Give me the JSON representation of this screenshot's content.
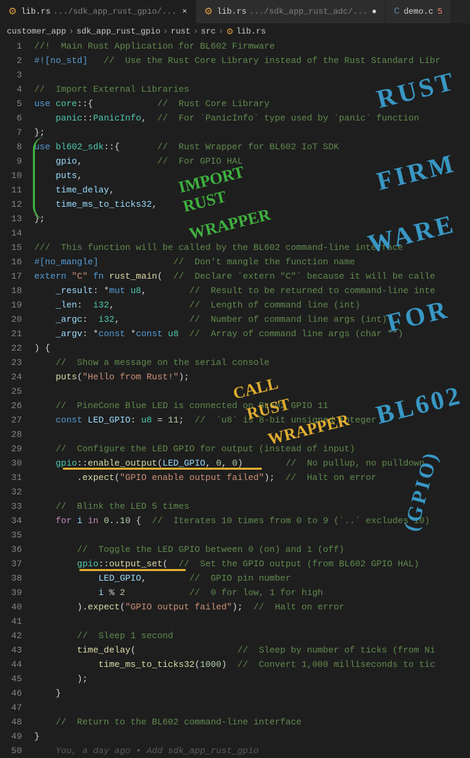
{
  "tabs": [
    {
      "icon": "⚙",
      "iconClass": "rust-icon",
      "name": "lib.rs",
      "path": ".../sdk_app_rust_gpio/...",
      "active": true,
      "close": true
    },
    {
      "icon": "⚙",
      "iconClass": "rust-icon",
      "name": "lib.rs",
      "path": ".../sdk_app_rust_adc/...",
      "active": false,
      "modified": true
    },
    {
      "icon": "C",
      "iconClass": "c-icon",
      "name": "demo.c",
      "count": "5",
      "active": false
    }
  ],
  "breadcrumbs": [
    "customer_app",
    "sdk_app_rust_gpio",
    "rust",
    "src",
    "lib.rs"
  ],
  "lines": [
    {
      "n": 1,
      "html": "<span class='doc-comment'>//!  Main Rust Application for BL602 Firmware</span>"
    },
    {
      "n": 2,
      "html": "<span class='attr'>#![no_std]</span>   <span class='comment'>//  Use the Rust Core Library instead of the Rust Standard Libr</span>"
    },
    {
      "n": 3,
      "html": ""
    },
    {
      "n": 4,
      "html": "<span class='comment'>//  Import External Libraries</span>"
    },
    {
      "n": 5,
      "html": "<span class='kw-use'>use</span> <span class='mod-name'>core</span><span class='punct'>::{</span>            <span class='comment'>//  Rust Core Library</span>"
    },
    {
      "n": 6,
      "html": "    <span class='mod-name'>panic</span><span class='punct'>::</span><span class='type'>PanicInfo</span><span class='punct'>,</span>  <span class='comment'>//  For `PanicInfo` type used by `panic` function</span>"
    },
    {
      "n": 7,
      "html": "<span class='punct'>};</span>"
    },
    {
      "n": 8,
      "html": "<span class='kw-use'>use</span> <span class='mod-name'>bl602_sdk</span><span class='punct'>::{</span>       <span class='comment'>//  Rust Wrapper for BL602 IoT SDK</span>"
    },
    {
      "n": 9,
      "html": "    <span class='ident'>gpio</span><span class='punct'>,</span>              <span class='comment'>//  For GPIO HAL</span>"
    },
    {
      "n": 10,
      "html": "    <span class='ident'>puts</span><span class='punct'>,</span>"
    },
    {
      "n": 11,
      "html": "    <span class='ident'>time_delay</span><span class='punct'>,</span>"
    },
    {
      "n": 12,
      "html": "    <span class='ident'>time_ms_to_ticks32</span><span class='punct'>,</span>"
    },
    {
      "n": 13,
      "html": "<span class='punct'>};</span>"
    },
    {
      "n": 14,
      "html": ""
    },
    {
      "n": 15,
      "html": "<span class='comment'>///  This function will be called by the BL602 command-line interface</span>"
    },
    {
      "n": 16,
      "html": "<span class='attr'>#[no_mangle]</span>              <span class='comment'>//  Don't mangle the function name</span>"
    },
    {
      "n": 17,
      "html": "<span class='keyword'>extern</span> <span class='string'>\"C\"</span> <span class='keyword'>fn</span> <span class='fn-name'>rust_main</span><span class='punct'>(</span>  <span class='comment'>//  Declare `extern \"C\"` because it will be calle</span>"
    },
    {
      "n": 18,
      "html": "    <span class='ident'>_result</span><span class='punct'>:</span> <span class='op'>*</span><span class='keyword'>mut</span> <span class='type'>u8</span><span class='punct'>,</span>        <span class='comment'>//  Result to be returned to command-line inte</span>"
    },
    {
      "n": 19,
      "html": "    <span class='ident'>_len</span><span class='punct'>:</span>  <span class='type'>i32</span><span class='punct'>,</span>              <span class='comment'>//  Length of command line (int)</span>"
    },
    {
      "n": 20,
      "html": "    <span class='ident'>_argc</span><span class='punct'>:</span>  <span class='type'>i32</span><span class='punct'>,</span>             <span class='comment'>//  Number of command line args (int)</span>"
    },
    {
      "n": 21,
      "html": "    <span class='ident'>_argv</span><span class='punct'>:</span> <span class='op'>*</span><span class='keyword'>const</span> <span class='op'>*</span><span class='keyword'>const</span> <span class='type'>u8</span>  <span class='comment'>//  Array of command line args (char **)</span>"
    },
    {
      "n": 22,
      "html": "<span class='punct'>) {</span>"
    },
    {
      "n": 23,
      "html": "    <span class='comment'>//  Show a message on the serial console</span>"
    },
    {
      "n": 24,
      "html": "    <span class='fn-name'>puts</span><span class='punct'>(</span><span class='string'>\"Hello from Rust!\"</span><span class='punct'>);</span>"
    },
    {
      "n": 25,
      "html": ""
    },
    {
      "n": 26,
      "html": "    <span class='comment'>//  PineCone Blue LED is connected on BL602 GPIO 11</span>"
    },
    {
      "n": 27,
      "html": "    <span class='kw-const'>const</span> <span class='ident'>LED_GPIO</span><span class='punct'>:</span> <span class='type'>u8</span> <span class='op'>=</span> <span class='number'>11</span><span class='punct'>;</span>  <span class='comment'>//  `u8` is 8-bit unsigned integer</span>"
    },
    {
      "n": 28,
      "html": ""
    },
    {
      "n": 29,
      "html": "    <span class='comment'>//  Configure the LED GPIO for output (instead of input)</span>"
    },
    {
      "n": 30,
      "html": "    <span class='mod-name'>gpio</span><span class='punct'>::</span><span class='fn-name'>enable_output</span><span class='punct'>(</span><span class='ident'>LED_GPIO</span><span class='punct'>,</span> <span class='number'>0</span><span class='punct'>,</span> <span class='number'>0</span><span class='punct'>)</span>        <span class='comment'>//  No pullup, no pulldown</span>"
    },
    {
      "n": 31,
      "html": "        <span class='punct'>.</span><span class='fn-name'>expect</span><span class='punct'>(</span><span class='string'>\"GPIO enable output failed\"</span><span class='punct'>);</span>  <span class='comment'>//  Halt on error</span>"
    },
    {
      "n": 32,
      "html": ""
    },
    {
      "n": 33,
      "html": "    <span class='comment'>//  Blink the LED 5 times</span>"
    },
    {
      "n": 34,
      "html": "    <span class='kw-for'>for</span> <span class='ident'>i</span> <span class='kw-in'>in</span> <span class='number'>0</span><span class='op'>..</span><span class='number'>10</span> <span class='punct'>{</span>  <span class='comment'>//  Iterates 10 times from 0 to 9 (`..` excludes 10)</span>"
    },
    {
      "n": 35,
      "html": ""
    },
    {
      "n": 36,
      "html": "        <span class='comment'>//  Toggle the LED GPIO between 0 (on) and 1 (off)</span>"
    },
    {
      "n": 37,
      "html": "        <span class='mod-name'>gpio</span><span class='punct'>::</span><span class='fn-name'>output_set</span><span class='punct'>(</span>  <span class='comment'>//  Set the GPIO output (from BL602 GPIO HAL)</span>"
    },
    {
      "n": 38,
      "html": "            <span class='ident'>LED_GPIO</span><span class='punct'>,</span>        <span class='comment'>//  GPIO pin number</span>"
    },
    {
      "n": 39,
      "html": "            <span class='ident'>i</span> <span class='op'>%</span> <span class='number'>2</span>            <span class='comment'>//  0 for low, 1 for high</span>"
    },
    {
      "n": 40,
      "html": "        <span class='punct'>)</span><span class='punct'>.</span><span class='fn-name'>expect</span><span class='punct'>(</span><span class='string'>\"GPIO output failed\"</span><span class='punct'>);</span>  <span class='comment'>//  Halt on error</span>"
    },
    {
      "n": 41,
      "html": ""
    },
    {
      "n": 42,
      "html": "        <span class='comment'>//  Sleep 1 second</span>"
    },
    {
      "n": 43,
      "html": "        <span class='fn-name'>time_delay</span><span class='punct'>(</span>                   <span class='comment'>//  Sleep by number of ticks (from Ni</span>"
    },
    {
      "n": 44,
      "html": "            <span class='fn-name'>time_ms_to_ticks32</span><span class='punct'>(</span><span class='number'>1000</span><span class='punct'>)</span>  <span class='comment'>//  Convert 1,000 milliseconds to tic</span>"
    },
    {
      "n": 45,
      "html": "        <span class='punct'>);</span>"
    },
    {
      "n": 46,
      "html": "    <span class='punct'>}</span>"
    },
    {
      "n": 47,
      "html": ""
    },
    {
      "n": 48,
      "html": "    <span class='comment'>//  Return to the BL602 command-line interface</span>"
    },
    {
      "n": 49,
      "html": "<span class='punct'>}</span>"
    },
    {
      "n": 50,
      "html": "    <span class='blame'>You, a day ago • Add sdk_app_rust_gpio</span>"
    }
  ],
  "annotations": {
    "rust": "RUST",
    "firm": "FIRM",
    "ware": "WARE",
    "for": "FOR",
    "bl602": "BL602",
    "gpio": "(GPIO)",
    "import": "IMPORT",
    "rustw": "RUST",
    "wrapper": "WRAPPER",
    "call": "CALL",
    "rust2": "RUST",
    "wrapper2": "WRAPPER"
  }
}
